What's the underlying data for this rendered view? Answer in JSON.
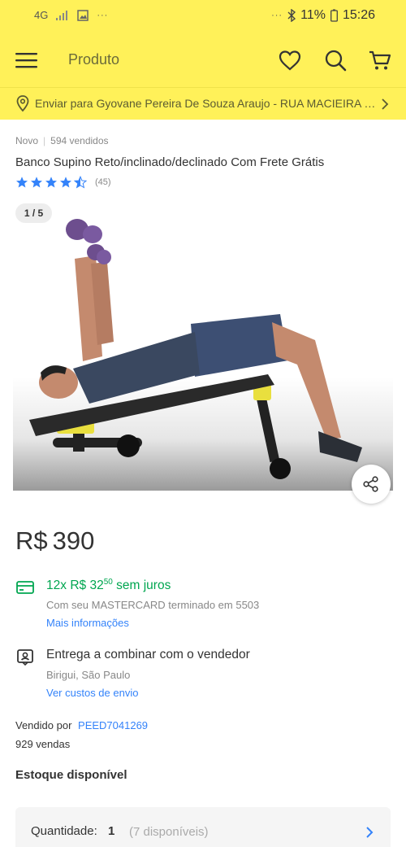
{
  "status_bar": {
    "left_indicators": [
      "4G",
      "signal",
      "image",
      "..."
    ],
    "dots": "···",
    "battery": "11%",
    "time": "15:26"
  },
  "header": {
    "title": "Produto",
    "icons": [
      "menu-icon",
      "heart-icon",
      "search-icon",
      "cart-icon"
    ]
  },
  "address": {
    "text": "Enviar para Gyovane Pereira De Souza Araujo - RUA MACIEIRA DO..."
  },
  "product": {
    "condition": "Novo",
    "separator": "|",
    "sold": "594 vendidos",
    "title": "Banco Supino Reto/inclinado/declinado Com Frete Grátis",
    "rating": 4.5,
    "reviews": "(45)",
    "image_counter": "1 / 5"
  },
  "price": {
    "currency": "R$",
    "amount": "390"
  },
  "installments": {
    "count": "12x",
    "currency": "R$",
    "value": "32",
    "cents": "50",
    "suffix": "sem juros",
    "card_note": "Com seu MASTERCARD terminado em 5503",
    "more_link": "Mais informações"
  },
  "delivery": {
    "title": "Entrega a combinar com o vendedor",
    "location": "Birigui, São Paulo",
    "costs_link": "Ver custos de envio"
  },
  "seller": {
    "label": "Vendido por",
    "name": "PEED7041269",
    "sales": "929 vendas"
  },
  "stock": {
    "title": "Estoque disponível",
    "quantity_label": "Quantidade:",
    "quantity_value": "1",
    "available": "(7 disponíveis)"
  },
  "colors": {
    "brand_yellow": "#fff159",
    "link_blue": "#3483fa",
    "success_green": "#00a650"
  }
}
